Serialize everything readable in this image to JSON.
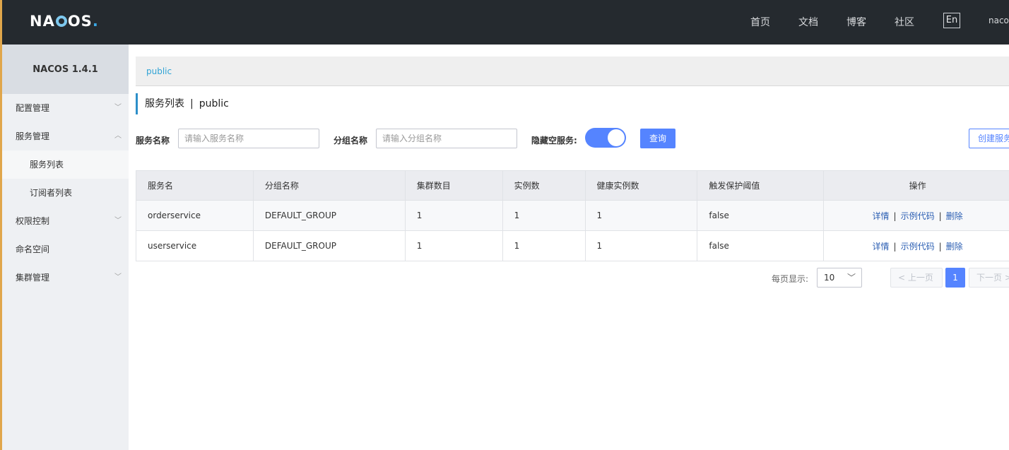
{
  "topbar": {
    "logo": {
      "pre": "NA",
      "ring": "C",
      "post": "OS",
      "dot": "."
    },
    "nav": [
      "首页",
      "文档",
      "博客",
      "社区"
    ],
    "lang": "En",
    "user": "nacos"
  },
  "sidebar": {
    "title": "NACOS 1.4.1",
    "items": [
      {
        "label": "配置管理",
        "chevron": "down"
      },
      {
        "label": "服务管理",
        "chevron": "up"
      },
      {
        "label": "权限控制",
        "chevron": "down"
      },
      {
        "label": "命名空间"
      },
      {
        "label": "集群管理",
        "chevron": "down"
      }
    ],
    "sub": [
      "服务列表",
      "订阅者列表"
    ]
  },
  "breadcrumb": {
    "namespace": "public"
  },
  "page": {
    "title": "服务列表",
    "separator": "|",
    "namespace": "public"
  },
  "filters": {
    "service_label": "服务名称",
    "service_placeholder": "请输入服务名称",
    "group_label": "分组名称",
    "group_placeholder": "请输入分组名称",
    "hide_empty_label": "隐藏空服务:",
    "hide_empty_on": true,
    "query_button": "查询",
    "create_button": "创建服务"
  },
  "table": {
    "headers": [
      "服务名",
      "分组名称",
      "集群数目",
      "实例数",
      "健康实例数",
      "触发保护阈值",
      "操作"
    ],
    "rows": [
      [
        "orderservice",
        "DEFAULT_GROUP",
        "1",
        "1",
        "1",
        "false"
      ],
      [
        "userservice",
        "DEFAULT_GROUP",
        "1",
        "1",
        "1",
        "false"
      ]
    ],
    "ops": {
      "detail": "详情",
      "sample": "示例代码",
      "delete": "删除",
      "sep": "|"
    }
  },
  "pagination": {
    "per_page_label": "每页显示:",
    "per_page": "10",
    "prev": "< 上一页",
    "next": "下一页 >",
    "current": "1"
  },
  "colors": {
    "accent": "#5584ff",
    "topbar": "#252a2f",
    "link": "#2c5fb3",
    "ns": "#2fa3d5"
  }
}
